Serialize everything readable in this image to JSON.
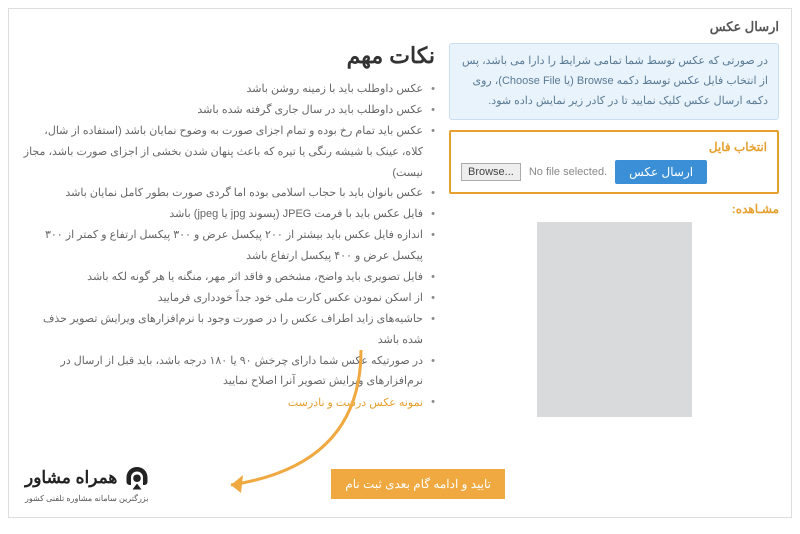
{
  "page": {
    "title": "ارسال عکس"
  },
  "info": {
    "text": "در صورتی که عکس توسط شما تمامی شرایط را دارا می باشد، پس از انتخاب فایل عکس توسط دکمه Browse (یا Choose File)، روی دکمه ارسال عکس کلیک نمایید تا در کادر زیر نمایش داده شود."
  },
  "fileSelect": {
    "label": "انتخاب فایل",
    "browse": "Browse...",
    "noFile": "No file selected.",
    "send": "ارسال عکس"
  },
  "preview": {
    "label": "مشـاهده:"
  },
  "notes": {
    "title": "نکات مهم",
    "items": [
      "عکس داوطلب باید با زمینه روشن باشد",
      "عکس داوطلب باید در سال جاری گرفته شده باشد",
      "عکس باید تمام رخ بوده و تمام اجزای صورت به وضوح نمایان باشد (استفاده از شال، کلاه، عینک با شیشه رنگی یا تیره که باعث پنهان شدن بخشی از اجزای صورت باشد، مجاز نیست)",
      "عکس بانوان باید با حجاب اسلامی بوده اما گردی صورت بطور کامل نمایان باشد",
      "فایل عکس باید با فرمت JPEG (پسوند jpg یا jpeg) باشد",
      "اندازه فایل عکس باید بیشتر از ۲۰۰ پیکسل عرض و ۳۰۰ پیکسل ارتفاع و کمتر از ۳۰۰ پیکسل عرض و ۴۰۰ پیکسل ارتفاع باشد",
      "فایل تصویری باید واضح، مشخص و فاقد اثر مهر، منگنه یا هر گونه لکه باشد",
      "از اسکن نمودن عکس کارت ملی خود جداً خودداری فرمایید",
      "حاشیه‌های زاید اطراف عکس را در صورت وجود با نرم‌افزارهای ویرایش تصویر حذف شده باشد",
      "در صورتیکه عکس شما دارای چرخش ۹۰ یا ۱۸۰ درجه باشد، باید قبل از ارسال در نرم‌افزارهای ویرایش تصویر آنرا اصلاح نمایید"
    ],
    "link": "نمونه عکس درست و نادرست"
  },
  "confirm": {
    "label": "تایید و ادامه گام بعدی ثبت نام"
  },
  "brand": {
    "main": "همراه مشاور",
    "sub": "بزرگترین سامانه مشاوره تلفنی کشور"
  }
}
